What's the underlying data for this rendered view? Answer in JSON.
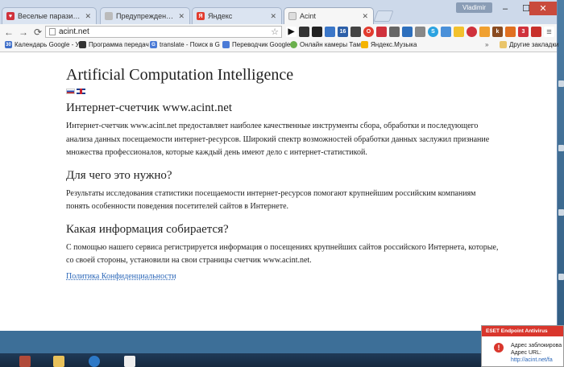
{
  "tabs": [
    {
      "title": "Веселые паразиты!)",
      "icon": "heart-icon",
      "color": "#d0323c"
    },
    {
      "title": "Предупреждение — ESET",
      "icon": "page-icon",
      "color": "#888888"
    },
    {
      "title": "Яндекс",
      "icon": "yandex-icon",
      "color": "#e23b2e"
    },
    {
      "title": "Acint",
      "icon": "page-icon",
      "color": "#888888",
      "active": true
    }
  ],
  "window": {
    "user": "Vladimir",
    "minimize": "–",
    "maximize": "☐",
    "close": "✕"
  },
  "toolbar": {
    "back": "←",
    "forward": "→",
    "reload": "⟳",
    "url": "acint.net",
    "star": "☆"
  },
  "bookmarks": [
    {
      "label": "Календарь Google - У",
      "icon_text": "30",
      "color": "#3d6ec9"
    },
    {
      "label": "Программа передач",
      "icon_text": "",
      "color": "#333333"
    },
    {
      "label": "translate - Поиск в G",
      "icon_text": "G",
      "color": "#4a7ad6"
    },
    {
      "label": "Переводчик Google",
      "icon_text": "",
      "color": "#4a7ad6"
    },
    {
      "label": "Онлайн камеры Там",
      "icon_text": "",
      "color": "#6ab04c"
    },
    {
      "label": "Яндекс.Музыка",
      "icon_text": "",
      "color": "#f5b400"
    },
    {
      "label": "Другие закладки",
      "icon_text": "",
      "color": "#e9c46a"
    }
  ],
  "page": {
    "title": "Artificial Computation Intelligence",
    "sections": [
      {
        "heading": "Интернет-счетчик www.acint.net",
        "text": "Интернет-счетчик www.acint.net предоставляет наиболее качественные инструменты сбора, обработки и последующего анализа данных посещаемости интернет-ресурсов. Широкий спектр возможностей обработки данных заслужил признание множества профессионалов, которые каждый день имеют дело с интернет-статистикой."
      },
      {
        "heading": "Для чего это нужно?",
        "text": "Результаты исследования статистики посещаемости интернет-ресурсов помогают крупнейшим российским компаниям понять особенности поведения посетителей сайтов в Интернете."
      },
      {
        "heading": "Какая информация собирается?",
        "text": "С помощью нашего сервиса регистрируется информация о посещениях крупнейших сайтов российского Интернета, которые, со своей стороны, установили на свои страницы счетчик www.acint.net."
      }
    ],
    "privacy_link": "Политика Конфиденциальности"
  },
  "notification": {
    "title": "ESET Endpoint Antivirus",
    "line1": "Адрес заблокирова",
    "line2": "Адрес URL:",
    "line3": "http://acint.net/fa"
  }
}
